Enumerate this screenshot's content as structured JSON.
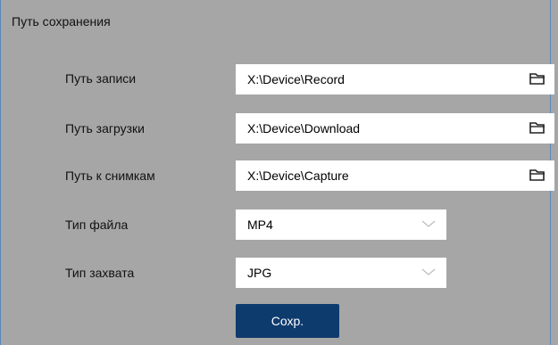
{
  "panel": {
    "title": "Путь сохранения"
  },
  "fields": {
    "record": {
      "label": "Путь записи",
      "value": "X:\\Device\\Record",
      "icon": "folder-icon"
    },
    "download": {
      "label": "Путь загрузки",
      "value": "X:\\Device\\Download",
      "icon": "folder-icon"
    },
    "capture": {
      "label": "Путь к снимкам",
      "value": "X:\\Device\\Capture",
      "icon": "folder-icon"
    },
    "file_type": {
      "label": "Тип файла",
      "value": "MP4",
      "icon": "chevron-down-icon"
    },
    "capture_type": {
      "label": "Тип захвата",
      "value": "JPG",
      "icon": "chevron-down-icon"
    }
  },
  "actions": {
    "save_label": "Сохр."
  },
  "colors": {
    "background": "#a6a6a6",
    "button": "#0e3b6e",
    "frame_border": "#5a86b8"
  }
}
